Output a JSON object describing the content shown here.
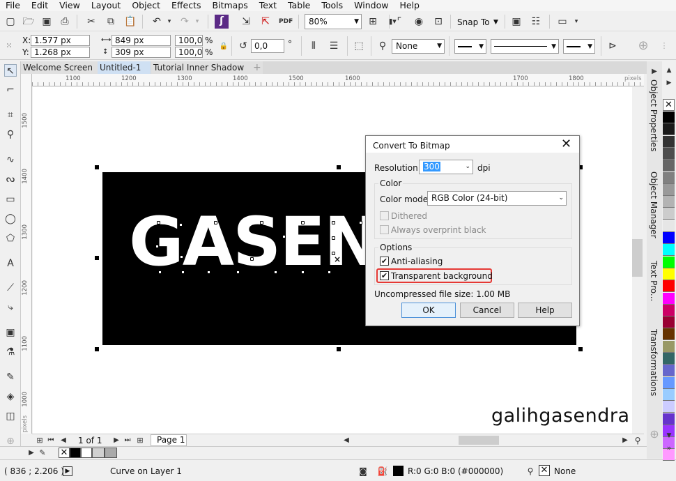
{
  "menu": [
    "File",
    "Edit",
    "View",
    "Layout",
    "Object",
    "Effects",
    "Bitmaps",
    "Text",
    "Table",
    "Tools",
    "Window",
    "Help"
  ],
  "toolbar": {
    "zoom": "80%",
    "snap_to": "Snap To"
  },
  "property_bar": {
    "x_label": "X:",
    "x_value": "1.577 px",
    "y_label": "Y:",
    "y_value": "1.268 px",
    "width": "849 px",
    "height": "309 px",
    "scale_w": "100,0",
    "scale_h": "100,0",
    "scale_unit": "%",
    "rotation": "0,0",
    "rotation_unit": "°",
    "outline_width": "None"
  },
  "tabs": [
    "Welcome Screen",
    "Untitled-1",
    "Tutorial Inner Shadow"
  ],
  "ruler": {
    "units": "pixels",
    "h_ticks": [
      "1100",
      "1200",
      "1300",
      "1400",
      "1500",
      "1600",
      "1700",
      "1800"
    ],
    "v_ticks": [
      "1500",
      "1400",
      "1300",
      "1200",
      "1100",
      "1000"
    ]
  },
  "canvas": {
    "artwork_text": "GASEN",
    "watermark": "galihgasendra"
  },
  "dialog": {
    "title": "Convert To Bitmap",
    "resolution_label": "Resolution:",
    "resolution_value": "300",
    "resolution_unit": "dpi",
    "color_group": "Color",
    "color_mode_label": "Color mode:",
    "color_mode_value": "RGB Color (24-bit)",
    "dithered": "Dithered",
    "overprint": "Always overprint black",
    "options_group": "Options",
    "anti_aliasing": "Anti-aliasing",
    "transparent_bg": "Transparent background",
    "file_size": "Uncompressed file size: 1.00 MB",
    "ok": "OK",
    "cancel": "Cancel",
    "help": "Help",
    "highlight_color": "#e53935"
  },
  "pages": {
    "counter": "1 of 1",
    "page_tab": "Page 1"
  },
  "dockers": [
    "Object Properties",
    "Object Manager",
    "Text Pro...",
    "Transformations"
  ],
  "status": {
    "coords": "( 836 ; 2.206 )",
    "object_info": "Curve on Layer 1",
    "fill_info": "R:0 G:0 B:0 (#000000)",
    "outline_info": "None"
  },
  "palette_colors": [
    "#ffffff",
    "#000000",
    "#1a1a1a",
    "#333333",
    "#4d4d4d",
    "#666666",
    "#808080",
    "#999999",
    "#b3b3b3",
    "#cccccc",
    "#e6e6e6",
    "#0000ff",
    "#00ffff",
    "#00ff00",
    "#ffff00",
    "#ff0000",
    "#ff00ff",
    "#cc0066",
    "#990033",
    "#663300",
    "#999966",
    "#336666",
    "#6666cc",
    "#6699ff",
    "#99ccff",
    "#ccccff",
    "#6633cc",
    "#9933ff",
    "#cc66ff",
    "#ff99ff"
  ]
}
